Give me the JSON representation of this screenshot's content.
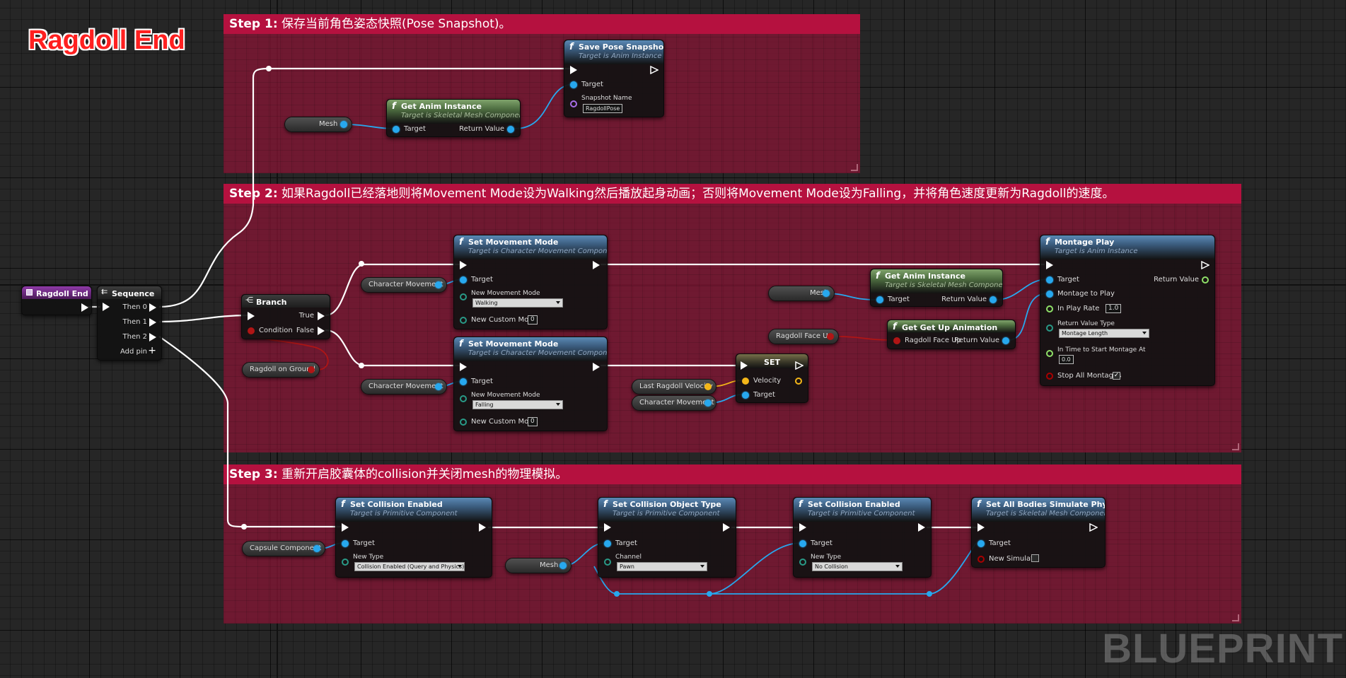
{
  "graph_title": "Ragdoll End",
  "comments": {
    "step1": {
      "head": "Step 1:",
      "text": " 保存当前角色姿态快照(Pose Snapshot)。"
    },
    "step2": {
      "head": "Step 2:",
      "text": " 如果Ragdoll已经落地则将Movement Mode设为Walking然后播放起身动画；否则将Movement Mode设为Falling，并将角色速度更新为Ragdoll的速度。"
    },
    "step3": {
      "head": "Step 3:",
      "text": " 重新开启胶囊体的collision并关闭mesh的物理模拟。"
    }
  },
  "nodes": {
    "ragdoll_end": {
      "title": "Ragdoll End"
    },
    "sequence": {
      "title": "Sequence",
      "then0": "Then 0",
      "then1": "Then 1",
      "then2": "Then 2",
      "add_pin": "Add pin"
    },
    "branch": {
      "title": "Branch",
      "condition": "Condition",
      "true": "True",
      "false": "False"
    },
    "save_pose": {
      "title": "Save Pose Snapshot",
      "subtitle": "Target is Anim Instance",
      "target": "Target",
      "snapshot_name": "Snapshot Name",
      "snapshot_value": "RagdollPose"
    },
    "get_anim_1": {
      "title": "Get Anim Instance",
      "subtitle": "Target is Skeletal Mesh Component",
      "target": "Target",
      "return": "Return Value"
    },
    "set_move_1": {
      "title": "Set Movement Mode",
      "subtitle": "Target is Character Movement Component",
      "target": "Target",
      "new_mode": "New Movement Mode",
      "mode_value": "Walking",
      "custom": "New Custom Mode",
      "custom_value": "0"
    },
    "set_move_2": {
      "title": "Set Movement Mode",
      "subtitle": "Target is Character Movement Component",
      "target": "Target",
      "new_mode": "New Movement Mode",
      "mode_value": "Falling",
      "custom": "New Custom Mode",
      "custom_value": "0"
    },
    "set_node": {
      "title": "SET",
      "velocity": "Velocity",
      "target": "Target"
    },
    "get_anim_2": {
      "title": "Get Anim Instance",
      "subtitle": "Target is Skeletal Mesh Component",
      "target": "Target",
      "return": "Return Value"
    },
    "get_up": {
      "title": "Get Get Up Animation",
      "face_up": "Ragdoll Face Up",
      "return": "Return Value"
    },
    "montage": {
      "title": "Montage Play",
      "subtitle": "Target is Anim Instance",
      "target": "Target",
      "return": "Return Value",
      "montage": "Montage to Play",
      "rate": "In Play Rate",
      "rate_value": "1.0",
      "rvt": "Return Value Type",
      "rvt_value": "Montage Length",
      "time": "In Time to Start Montage At",
      "time_value": "0.0",
      "stop": "Stop All Montages"
    },
    "collision_1": {
      "title": "Set Collision Enabled",
      "subtitle": "Target is Primitive Component",
      "target": "Target",
      "new_type": "New Type",
      "type_value": "Collision Enabled (Query and Physics)"
    },
    "object_type": {
      "title": "Set Collision Object Type",
      "subtitle": "Target is Primitive Component",
      "target": "Target",
      "channel": "Channel",
      "channel_value": "Pawn"
    },
    "collision_2": {
      "title": "Set Collision Enabled",
      "subtitle": "Target is Primitive Component",
      "target": "Target",
      "new_type": "New Type",
      "type_value": "No Collision"
    },
    "simulate": {
      "title": "Set All Bodies Simulate Physics",
      "subtitle": "Target is Skeletal Mesh Component",
      "target": "Target",
      "new_simulate": "New Simulate"
    }
  },
  "variables": {
    "mesh": "Mesh",
    "char_move": "Character Movement",
    "ragdoll_on_ground": "Ragdoll on Ground",
    "ragdoll_face_up": "Ragdoll Face Up",
    "last_velocity": "Last Ragdoll Velocity",
    "capsule": "Capsule Component"
  },
  "colors": {
    "comment": "#b5113f",
    "object_pin": "#27a8ee",
    "bool_pin": "#b01515",
    "vector_pin": "#f3b619",
    "exec_wire": "#ffffff"
  },
  "watermark": "BLUEPRINT"
}
